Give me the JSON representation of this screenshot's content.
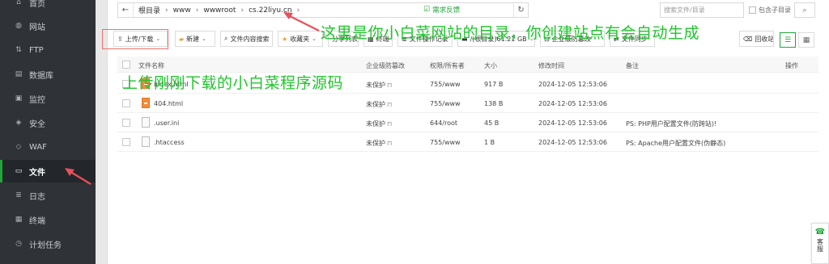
{
  "sidebar": {
    "items": [
      {
        "label": "首页",
        "icon": "home-icon",
        "glyph": "⌂"
      },
      {
        "label": "网站",
        "icon": "globe-icon",
        "glyph": "◍"
      },
      {
        "label": "FTP",
        "icon": "ftp-icon",
        "glyph": "⇅"
      },
      {
        "label": "数据库",
        "icon": "database-icon",
        "glyph": "▤"
      },
      {
        "label": "监控",
        "icon": "monitor-icon",
        "glyph": "▣"
      },
      {
        "label": "安全",
        "icon": "shield-icon",
        "glyph": "◈"
      },
      {
        "label": "WAF",
        "icon": "waf-icon",
        "glyph": "◇"
      },
      {
        "label": "文件",
        "icon": "folder-icon",
        "glyph": "▭",
        "active": true
      },
      {
        "label": "日志",
        "icon": "log-icon",
        "glyph": "≣"
      },
      {
        "label": "终端",
        "icon": "terminal-icon",
        "glyph": "▦"
      },
      {
        "label": "计划任务",
        "icon": "schedule-icon",
        "glyph": "◷"
      }
    ]
  },
  "address_bar": {
    "back_glyph": "←",
    "crumbs": [
      "根目录",
      "www",
      "wwwroot",
      "cs.22liyu.cn"
    ],
    "separator": "›",
    "refresh_glyph": "↻"
  },
  "feedback": {
    "label": "需求反馈",
    "glyph": "☑"
  },
  "search": {
    "placeholder": "搜索文件/目录",
    "include_subdir": "包含子目录",
    "button_glyph": "⌕"
  },
  "toolbar": {
    "upload": "上传/下载",
    "new": "新建",
    "content_search": "文件内容搜索",
    "favorites": "收藏夹",
    "share_list": "分享列表",
    "terminal": "终端",
    "file_log": "文件操作记录",
    "disk": "/(根目录)61.21 GB",
    "tamper": "企业级防篡改",
    "sync": "文件同步",
    "recycle": "回收站"
  },
  "table": {
    "headers": {
      "name": "文件名称",
      "tamper": "企业级防篡改",
      "perm": "权限/所有者",
      "size": "大小",
      "mtime": "修改时间",
      "remark": "备注",
      "action": "操作"
    },
    "rows": [
      {
        "name": "index.html",
        "type": "html",
        "tamper": "未保护",
        "perm": "755/www",
        "size": "917 B",
        "mtime": "2024-12-05 12:53:06",
        "remark": ""
      },
      {
        "name": "404.html",
        "type": "html",
        "tamper": "未保护",
        "perm": "755/www",
        "size": "138 B",
        "mtime": "2024-12-05 12:53:06",
        "remark": ""
      },
      {
        "name": ".user.ini",
        "type": "file",
        "tamper": "未保护",
        "perm": "644/root",
        "size": "45 B",
        "mtime": "2024-12-05 12:53:06",
        "remark": "PS: PHP用户配置文件(防跨站)!"
      },
      {
        "name": ".htaccess",
        "type": "file",
        "tamper": "未保护",
        "perm": "755/www",
        "size": "1 B",
        "mtime": "2024-12-05 12:53:06",
        "remark": "PS: Apache用户配置文件(伪静态)"
      }
    ]
  },
  "annotations": {
    "top": "这里是你小白菜网站的目录，你创建站点有会自动生成",
    "left": "上传刚刚下载的小白菜程序源码"
  },
  "service_widget": {
    "label": "客服",
    "glyph": "☎"
  },
  "colors": {
    "accent": "#20a53a",
    "annotation_text": "#21c42e",
    "annotation_arrow": "#e8505b",
    "sidebar_bg": "#2f3337"
  }
}
